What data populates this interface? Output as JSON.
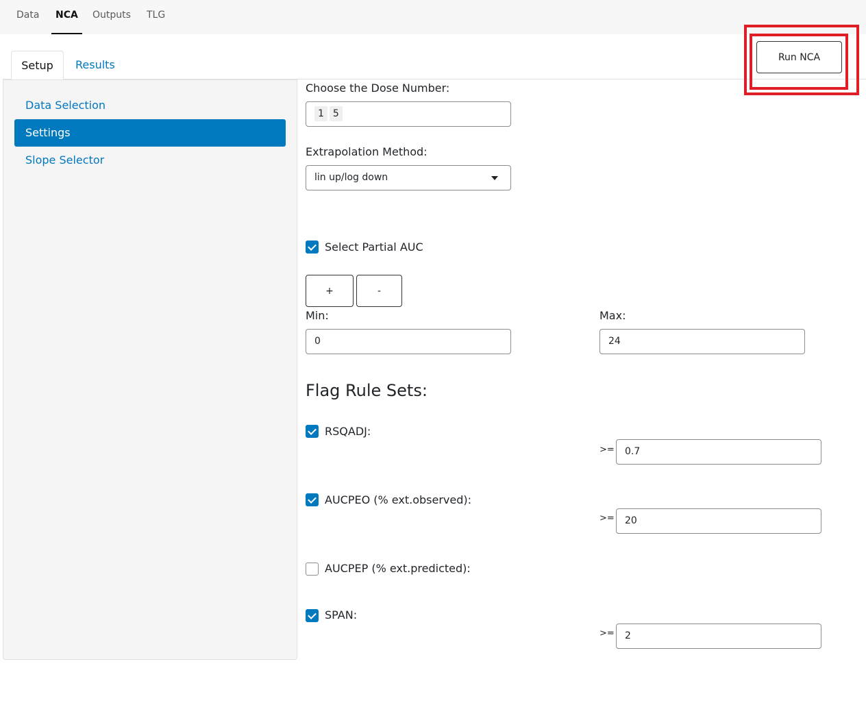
{
  "top_nav": {
    "tabs": [
      {
        "label": "Data",
        "active": false
      },
      {
        "label": "NCA",
        "active": true
      },
      {
        "label": "Outputs",
        "active": false
      },
      {
        "label": "TLG",
        "active": false
      }
    ]
  },
  "sub_tabs": [
    {
      "label": "Setup",
      "active": true
    },
    {
      "label": "Results",
      "active": false
    }
  ],
  "run_button": {
    "label": "Run NCA"
  },
  "highlight": {
    "color": "#e01e25",
    "target": "run-nca-button"
  },
  "sidebar": {
    "items": [
      {
        "label": "Data Selection",
        "active": false
      },
      {
        "label": "Settings",
        "active": true
      },
      {
        "label": "Slope Selector",
        "active": false
      }
    ],
    "active_color": "#0079be"
  },
  "settings": {
    "dose_number": {
      "label": "Choose the Dose Number:",
      "selected": [
        "1",
        "5"
      ]
    },
    "extrapolation": {
      "label": "Extrapolation Method:",
      "value": "lin up/log down",
      "icon": "chevron-down-icon"
    },
    "partial_auc": {
      "label": "Select Partial AUC",
      "checked": true,
      "add_label": "+",
      "remove_label": "-",
      "min": {
        "label": "Min:",
        "value": "0"
      },
      "max": {
        "label": "Max:",
        "value": "24"
      }
    },
    "flag_rules": {
      "title": "Flag Rule Sets:",
      "operator": ">=",
      "rules": [
        {
          "label": "RSQADJ:",
          "checked": true,
          "value": "0.7"
        },
        {
          "label": "AUCPEO (% ext.observed):",
          "checked": true,
          "value": "20"
        },
        {
          "label": "AUCPEP (% ext.predicted):",
          "checked": false,
          "value": null
        },
        {
          "label": "SPAN:",
          "checked": true,
          "value": "2"
        }
      ]
    }
  }
}
